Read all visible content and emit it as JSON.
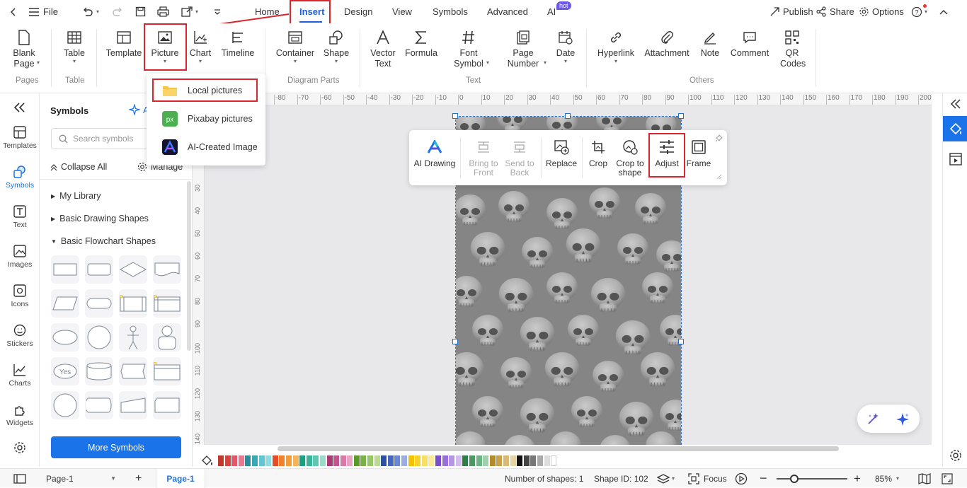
{
  "topbar": {
    "file_label": "File",
    "tabs": [
      "Home",
      "Insert",
      "Design",
      "View",
      "Symbols",
      "Advanced",
      "AI"
    ],
    "ai_badge": "hot",
    "publish_label": "Publish",
    "share_label": "Share",
    "options_label": "Options"
  },
  "ribbon": {
    "buttons": {
      "blank_page": "Blank Page",
      "table": "Table",
      "template": "Template",
      "picture": "Picture",
      "chart": "Chart",
      "timeline": "Timeline",
      "container": "Container",
      "shape": "Shape",
      "vector_text": "Vector Text",
      "formula": "Formula",
      "font_symbol": "Font Symbol",
      "page_number": "Page Number",
      "date": "Date",
      "hyperlink": "Hyperlink",
      "attachment": "Attachment",
      "note": "Note",
      "comment": "Comment",
      "qr_codes": "QR Codes"
    },
    "groups": {
      "pages": "Pages",
      "table": "Table",
      "diagram_parts": "Diagram Parts",
      "text": "Text",
      "others": "Others"
    }
  },
  "picture_menu": {
    "items": [
      "Local pictures",
      "Pixabay pictures",
      "AI-Created Image"
    ]
  },
  "left_rail": {
    "items": [
      "Templates",
      "Symbols",
      "Text",
      "Images",
      "Icons",
      "Stickers",
      "Charts",
      "Widgets"
    ]
  },
  "symbols_panel": {
    "title": "Symbols",
    "ai_label": "A",
    "search_placeholder": "Search symbols",
    "collapse_all": "Collapse All",
    "manage": "Manage",
    "categories": [
      "My Library",
      "Basic Drawing Shapes",
      "Basic Flowchart Shapes"
    ],
    "yes_label": "Yes",
    "more_symbols": "More Symbols"
  },
  "ruler": {
    "h_ticks": [
      "-80",
      "-70",
      "-60",
      "-50",
      "-40",
      "-30",
      "-20",
      "-10",
      "0",
      "10",
      "20",
      "30",
      "40",
      "50",
      "60",
      "70",
      "80",
      "90",
      "100",
      "110",
      "120",
      "130",
      "140",
      "150",
      "160",
      "170",
      "180",
      "190",
      "200"
    ],
    "v_ticks": [
      "30",
      "40",
      "50",
      "60",
      "70",
      "80",
      "90",
      "100",
      "110",
      "120",
      "130",
      "140"
    ]
  },
  "float_toolbar": {
    "items": [
      "AI Drawing",
      "Bring to Front",
      "Send to Back",
      "Replace",
      "Crop",
      "Crop to shape",
      "Adjust",
      "Frame"
    ]
  },
  "status": {
    "page_select": "Page-1",
    "page_tab": "Page-1",
    "shape_count": "Number of shapes: 1",
    "shape_id": "Shape ID: 102",
    "focus": "Focus",
    "zoom": "85%"
  },
  "colors": {
    "accent": "#1a73e8",
    "highlight": "#d8262c"
  }
}
